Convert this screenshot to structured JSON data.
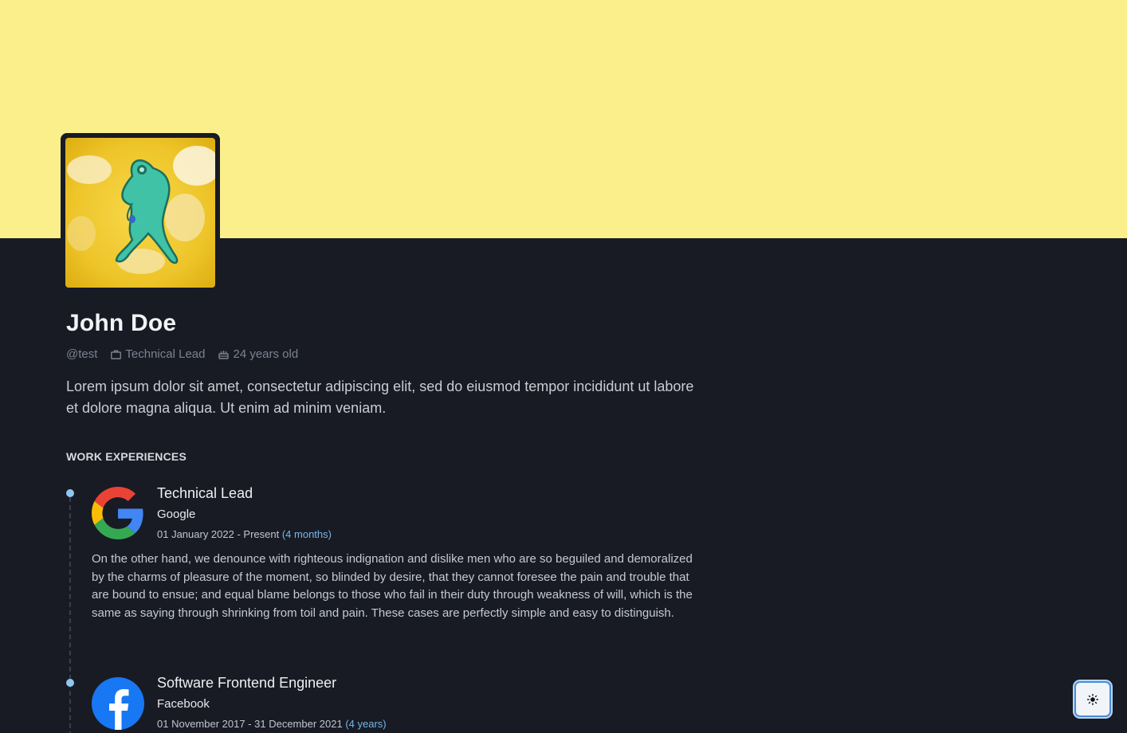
{
  "profile": {
    "name": "John Doe",
    "username": "@test",
    "position": "Technical Lead",
    "age": "24 years old",
    "bio": "Lorem ipsum dolor sit amet, consectetur adipiscing elit, sed do eiusmod tempor incididunt ut labore et dolore magna aliqua. Ut enim ad minim veniam."
  },
  "section_title": "WORK EXPERIENCES",
  "experiences": [
    {
      "title": "Technical Lead",
      "company": "Google",
      "dates": "01 January 2022 - Present",
      "duration": "(4 months)",
      "logo": "google-logo",
      "description": "On the other hand, we denounce with righteous indignation and dislike men who are so beguiled and demoralized by the charms of pleasure of the moment, so blinded by desire, that they cannot foresee the pain and trouble that are bound to ensue; and equal blame belongs to those who fail in their duty through weakness of will, which is the same as saying through shrinking from toil and pain. These cases are perfectly simple and easy to distinguish."
    },
    {
      "title": "Software Frontend Engineer",
      "company": "Facebook",
      "dates": "01 November 2017 - 31 December 2021",
      "duration": "(4 years)",
      "logo": "facebook-logo"
    }
  ],
  "icons": {
    "position": "briefcase-icon",
    "age": "cake-icon",
    "theme_toggle": "sun-icon"
  },
  "colors": {
    "banner": "#fbef8b",
    "background": "#181b24",
    "accent": "#74b6ea"
  }
}
